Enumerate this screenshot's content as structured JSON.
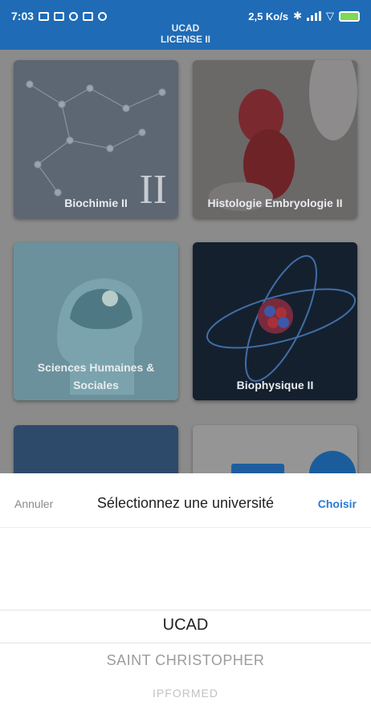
{
  "status_bar": {
    "time": "7:03",
    "speed": "2,5 Ko/s"
  },
  "app_bar": {
    "title": "UCAD",
    "subtitle": "LICENSE II"
  },
  "courses": [
    {
      "label": "Biochimie II",
      "badge": "II"
    },
    {
      "label": "Histologie Embryologie II"
    },
    {
      "label": "Sciences Humaines & Sociales"
    },
    {
      "label": "Biophysique II"
    }
  ],
  "picker": {
    "cancel_label": "Annuler",
    "title": "Sélectionnez une université",
    "choose_label": "Choisir",
    "options": [
      "UCAD",
      "SAINT CHRISTOPHER",
      "IPFORMED"
    ],
    "selected": "UCAD"
  },
  "colors": {
    "app_bar": "#1f6bb6",
    "accent": "#2a7bd6"
  }
}
